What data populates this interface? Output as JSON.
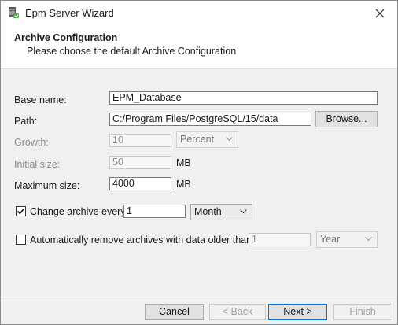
{
  "window": {
    "title": "Epm Server Wizard"
  },
  "icons": {
    "app": "server-icon",
    "close": "close-icon",
    "dropdown": "chevron-down-icon",
    "checkmark": "checkmark-icon"
  },
  "header": {
    "title": "Archive Configuration",
    "subtitle": "Please choose the default Archive Configuration"
  },
  "form": {
    "base_name": {
      "label": "Base name:",
      "value": "EPM_Database"
    },
    "path": {
      "label": "Path:",
      "value": "C:/Program Files/PostgreSQL/15/data",
      "browse_label": "Browse..."
    },
    "growth": {
      "label": "Growth:",
      "value": "10",
      "unit": "Percent"
    },
    "initial_size": {
      "label": "Initial size:",
      "value": "50",
      "unit": "MB"
    },
    "maximum_size": {
      "label": "Maximum size:",
      "value": "4000",
      "unit": "MB"
    },
    "change_archive": {
      "checked": true,
      "label": "Change archive every",
      "value": "1",
      "unit": "Month"
    },
    "auto_remove": {
      "checked": false,
      "label": "Automatically remove archives with data older than",
      "value": "1",
      "unit": "Year"
    }
  },
  "footer": {
    "cancel": "Cancel",
    "back": "< Back",
    "next": "Next >",
    "finish": "Finish"
  },
  "colors": {
    "accent": "#0078d7",
    "disabled_text": "#8c8c8c"
  }
}
